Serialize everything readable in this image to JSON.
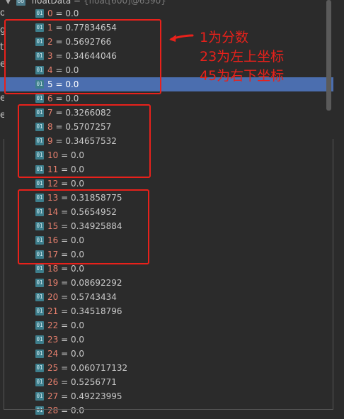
{
  "header": {
    "name": "floatData",
    "type": "{float[600]@6590}"
  },
  "left_glyphs": [
    "o",
    "g",
    "t",
    "e",
    "e",
    "e",
    "e"
  ],
  "rows": [
    {
      "index": "0",
      "value": "0.0"
    },
    {
      "index": "1",
      "value": "0.77834654"
    },
    {
      "index": "2",
      "value": "0.5692766"
    },
    {
      "index": "3",
      "value": "0.34644046"
    },
    {
      "index": "4",
      "value": "0.0"
    },
    {
      "index": "5",
      "value": "0.0"
    },
    {
      "index": "6",
      "value": "0.0"
    },
    {
      "index": "7",
      "value": "0.3266082"
    },
    {
      "index": "8",
      "value": "0.5707257"
    },
    {
      "index": "9",
      "value": "0.34657532"
    },
    {
      "index": "10",
      "value": "0.0"
    },
    {
      "index": "11",
      "value": "0.0"
    },
    {
      "index": "12",
      "value": "0.0"
    },
    {
      "index": "13",
      "value": "0.31858775"
    },
    {
      "index": "14",
      "value": "0.5654952"
    },
    {
      "index": "15",
      "value": "0.34925884"
    },
    {
      "index": "16",
      "value": "0.0"
    },
    {
      "index": "17",
      "value": "0.0"
    },
    {
      "index": "18",
      "value": "0.0"
    },
    {
      "index": "19",
      "value": "0.08692292"
    },
    {
      "index": "20",
      "value": "0.5743434"
    },
    {
      "index": "21",
      "value": "0.34518796"
    },
    {
      "index": "22",
      "value": "0.0"
    },
    {
      "index": "23",
      "value": "0.0"
    },
    {
      "index": "24",
      "value": "0.0"
    },
    {
      "index": "25",
      "value": "0.060717132"
    },
    {
      "index": "26",
      "value": "0.5256771"
    },
    {
      "index": "27",
      "value": "0.49223995"
    },
    {
      "index": "28",
      "value": "0.0"
    }
  ],
  "selected_index": "5",
  "badge_text": "01",
  "annotation": {
    "line1": "1为分数",
    "line2": "23为左上坐标",
    "line3": "45为右下坐标"
  },
  "colors": {
    "background": "#2b2b2b",
    "selection": "#4b6eaf",
    "index_text": "#e8806e",
    "annotation_red": "#e8211b",
    "badge": "#3d7e8c"
  }
}
